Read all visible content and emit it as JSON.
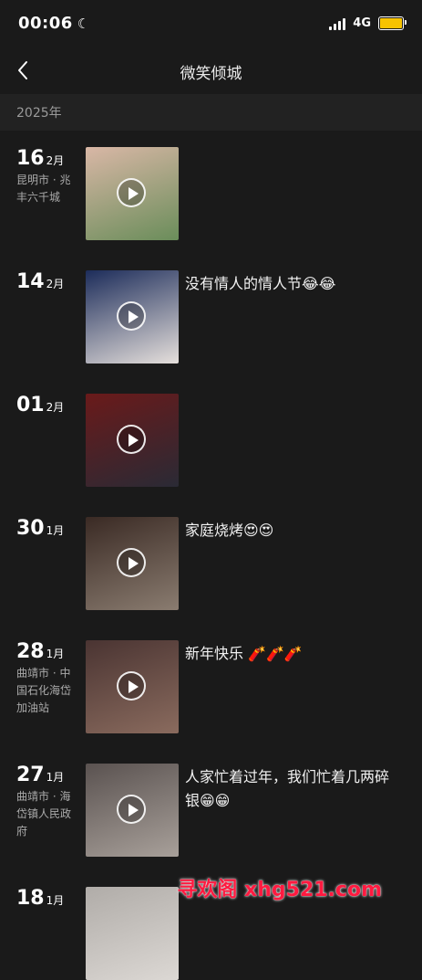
{
  "status": {
    "time": "00:06",
    "network": "4G",
    "battery_color": "#f7c300"
  },
  "nav": {
    "title": "微笑倾城",
    "back_icon": "chevron-left-icon"
  },
  "year": "2025年",
  "entries": [
    {
      "day": "16",
      "month": "2月",
      "location": "昆明市 · 兆丰六千城",
      "caption": "",
      "thumb_colors": [
        "#d9b7a6",
        "#6a8d5a"
      ]
    },
    {
      "day": "14",
      "month": "2月",
      "location": "",
      "caption": "没有情人的情人节😂😂",
      "thumb_colors": [
        "#1c2c5a",
        "#e6e0dc"
      ]
    },
    {
      "day": "01",
      "month": "2月",
      "location": "",
      "caption": "",
      "thumb_colors": [
        "#6a1a1a",
        "#2a2a35"
      ]
    },
    {
      "day": "30",
      "month": "1月",
      "location": "",
      "caption": "家庭烧烤😍😍",
      "thumb_colors": [
        "#3a2a24",
        "#8a7c70"
      ]
    },
    {
      "day": "28",
      "month": "1月",
      "location": "曲靖市 · 中国石化海岱加油站",
      "caption": "新年快乐 🧨🧨🧨",
      "thumb_colors": [
        "#4a3432",
        "#8a6b5e"
      ]
    },
    {
      "day": "27",
      "month": "1月",
      "location": "曲靖市 · 海岱镇人民政府",
      "caption": "人家忙着过年，我们忙着几两碎银😁😁",
      "thumb_colors": [
        "#5a5250",
        "#a8a09a"
      ]
    },
    {
      "day": "18",
      "month": "1月",
      "location": "",
      "caption": "",
      "thumb_colors": [
        "#b0aca8",
        "#dcd8d4"
      ]
    }
  ],
  "watermark": "寻欢阁 xhg521.com"
}
